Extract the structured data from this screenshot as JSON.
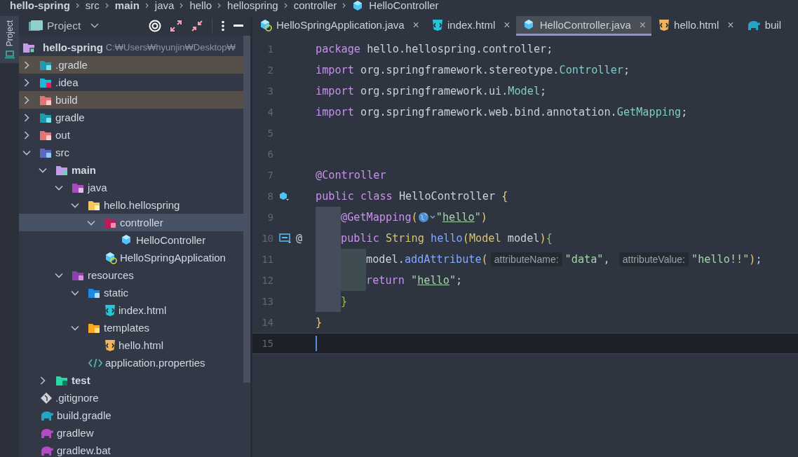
{
  "breadcrumb": [
    {
      "text": "hello-spring",
      "bold": true,
      "kind": "text"
    },
    {
      "text": "src",
      "bold": false,
      "kind": "text"
    },
    {
      "text": "main",
      "bold": true,
      "kind": "text"
    },
    {
      "text": "java",
      "bold": false,
      "kind": "text"
    },
    {
      "text": "hello",
      "bold": false,
      "kind": "text"
    },
    {
      "text": "hellospring",
      "bold": false,
      "kind": "text"
    },
    {
      "text": "controller",
      "bold": false,
      "kind": "text"
    },
    {
      "text": "HelloController",
      "bold": false,
      "kind": "class"
    }
  ],
  "side_strip": {
    "label": "Project",
    "selected": true
  },
  "project_panel": {
    "title": "Project",
    "root": {
      "name": "hello-spring",
      "path": "C:₩Users₩hyunjin₩Desktop₩",
      "kind": "module",
      "bold": true,
      "children": [
        {
          "name": ".gradle",
          "kind": "gradle-folder",
          "bold": false,
          "expanded": false,
          "ignored": true,
          "selected": false
        },
        {
          "name": ".idea",
          "kind": "idea-folder",
          "bold": false,
          "expanded": false,
          "ignored": false,
          "selected": false
        },
        {
          "name": "build",
          "kind": "excluded-folder",
          "bold": false,
          "expanded": false,
          "ignored": true,
          "selected": false
        },
        {
          "name": "gradle",
          "kind": "gradle-folder",
          "bold": false,
          "expanded": false,
          "ignored": false,
          "selected": false
        },
        {
          "name": "out",
          "kind": "excluded-folder",
          "bold": false,
          "expanded": false,
          "ignored": false,
          "selected": false
        },
        {
          "name": "src",
          "kind": "source-folder",
          "bold": false,
          "expanded": true,
          "ignored": false,
          "selected": false,
          "children": [
            {
              "name": "main",
              "kind": "module",
              "bold": true,
              "expanded": true,
              "ignored": false,
              "selected": false,
              "children": [
                {
                  "name": "java",
                  "kind": "java-root",
                  "bold": false,
                  "expanded": true,
                  "ignored": false,
                  "selected": false,
                  "children": [
                    {
                      "name": "hello.hellospring",
                      "kind": "package",
                      "bold": false,
                      "expanded": true,
                      "ignored": false,
                      "selected": false,
                      "children": [
                        {
                          "name": "controller",
                          "kind": "controller-package",
                          "bold": false,
                          "expanded": true,
                          "ignored": false,
                          "selected": true,
                          "children": [
                            {
                              "name": "HelloController",
                              "kind": "class",
                              "bold": false,
                              "ignored": false,
                              "selected": false
                            }
                          ]
                        },
                        {
                          "name": "HelloSpringApplication",
                          "kind": "spring-app",
                          "bold": false,
                          "ignored": false,
                          "selected": false
                        }
                      ]
                    }
                  ]
                },
                {
                  "name": "resources",
                  "kind": "resources",
                  "bold": false,
                  "expanded": true,
                  "ignored": false,
                  "selected": false,
                  "children": [
                    {
                      "name": "static",
                      "kind": "web-folder",
                      "bold": false,
                      "expanded": true,
                      "ignored": false,
                      "selected": false,
                      "children": [
                        {
                          "name": "index.html",
                          "kind": "web-file",
                          "bold": false,
                          "ignored": false,
                          "selected": false
                        }
                      ]
                    },
                    {
                      "name": "templates",
                      "kind": "template-folder",
                      "bold": false,
                      "expanded": true,
                      "ignored": false,
                      "selected": false,
                      "children": [
                        {
                          "name": "hello.html",
                          "kind": "html5",
                          "bold": false,
                          "ignored": false,
                          "selected": false
                        }
                      ]
                    },
                    {
                      "name": "application.properties",
                      "kind": "properties",
                      "bold": false,
                      "ignored": false,
                      "selected": false
                    }
                  ]
                }
              ]
            },
            {
              "name": "test",
              "kind": "test-folder",
              "bold": true,
              "expanded": false,
              "ignored": false,
              "selected": false
            }
          ]
        },
        {
          "name": ".gitignore",
          "kind": "gitignore",
          "bold": false,
          "ignored": false,
          "selected": false
        },
        {
          "name": "build.gradle",
          "kind": "gradle-file",
          "bold": false,
          "ignored": false,
          "selected": false
        },
        {
          "name": "gradlew",
          "kind": "gradlew",
          "bold": false,
          "ignored": false,
          "selected": false
        },
        {
          "name": "gradlew.bat",
          "kind": "gradlew",
          "bold": false,
          "ignored": false,
          "selected": false
        }
      ]
    }
  },
  "tabs": [
    {
      "label": "HelloSpringApplication.java",
      "kind": "spring-app",
      "selected": false,
      "close": "×"
    },
    {
      "label": "index.html",
      "kind": "web-file",
      "selected": false,
      "close": "×"
    },
    {
      "label": "HelloController.java",
      "kind": "class",
      "selected": true,
      "close": "×"
    },
    {
      "label": "hello.html",
      "kind": "html5",
      "selected": false,
      "close": "×"
    },
    {
      "label": "buil",
      "kind": "gradle-file",
      "selected": false
    }
  ],
  "code": [
    {
      "number": "1",
      "current": false,
      "tokens": [
        {
          "kind": "keyword",
          "text": "package"
        },
        {
          "kind": "plain",
          "text": " hello.hellospring.controller;"
        }
      ]
    },
    {
      "number": "2",
      "current": false,
      "tokens": [
        {
          "kind": "keyword",
          "text": "import"
        },
        {
          "kind": "plain",
          "text": " org.springframework.stereotype."
        },
        {
          "kind": "type",
          "text": "Controller"
        },
        {
          "kind": "plain",
          "text": ";"
        }
      ]
    },
    {
      "number": "3",
      "current": false,
      "tokens": [
        {
          "kind": "keyword",
          "text": "import"
        },
        {
          "kind": "plain",
          "text": " org.springframework.ui."
        },
        {
          "kind": "type",
          "text": "Model"
        },
        {
          "kind": "plain",
          "text": ";"
        }
      ]
    },
    {
      "number": "4",
      "current": false,
      "tokens": [
        {
          "kind": "keyword",
          "text": "import"
        },
        {
          "kind": "plain",
          "text": " org.springframework.web.bind.annotation."
        },
        {
          "kind": "type",
          "text": "GetMapping"
        },
        {
          "kind": "plain",
          "text": ";"
        }
      ]
    },
    {
      "number": "5",
      "current": false
    },
    {
      "number": "6",
      "current": false
    },
    {
      "number": "7",
      "current": false,
      "tokens": [
        {
          "kind": "annotation",
          "text": "@Controller"
        }
      ]
    },
    {
      "number": "8",
      "current": false,
      "gutter": [
        {
          "kind": "class"
        }
      ],
      "tokens": [
        {
          "kind": "keyword",
          "text": "public class"
        },
        {
          "kind": "plain",
          "text": " HelloController "
        },
        {
          "kind": "brace",
          "text": "{"
        }
      ]
    },
    {
      "number": "9",
      "current": false,
      "tokens": [
        {
          "kind": "indent"
        },
        {
          "kind": "annotation",
          "text": "@GetMapping"
        },
        {
          "kind": "brace",
          "text": "("
        },
        {
          "kind": "globe"
        },
        {
          "kind": "string",
          "text": "\""
        },
        {
          "kind": "link",
          "text": "hello"
        },
        {
          "kind": "string",
          "text": "\""
        },
        {
          "kind": "brace",
          "text": ")"
        }
      ]
    },
    {
      "number": "10",
      "current": false,
      "gutter": [
        {
          "kind": "api"
        },
        {
          "kind": "text",
          "text": "@"
        }
      ],
      "tokens": [
        {
          "kind": "indent"
        },
        {
          "kind": "keyword",
          "text": "public "
        },
        {
          "kind": "type2",
          "text": "String "
        },
        {
          "kind": "method",
          "text": "hello"
        },
        {
          "kind": "brace",
          "text": "("
        },
        {
          "kind": "type2",
          "text": "Model"
        },
        {
          "kind": "plain",
          "text": " model"
        },
        {
          "kind": "brace",
          "text": ")"
        },
        {
          "kind": "brace2",
          "text": "{"
        }
      ]
    },
    {
      "number": "11",
      "current": false,
      "tokens": [
        {
          "kind": "indent"
        },
        {
          "kind": "indent"
        },
        {
          "kind": "plain",
          "text": "model."
        },
        {
          "kind": "method",
          "text": "addAttribute"
        },
        {
          "kind": "brace",
          "text": "("
        },
        {
          "kind": "hint",
          "text": "attributeName:"
        },
        {
          "kind": "string",
          "text": "\"data\""
        },
        {
          "kind": "plain",
          "text": ", "
        },
        {
          "kind": "hint",
          "text": "attributeValue:"
        },
        {
          "kind": "string",
          "text": "\"hello!!\""
        },
        {
          "kind": "brace",
          "text": ")"
        },
        {
          "kind": "plain",
          "text": ";"
        }
      ]
    },
    {
      "number": "12",
      "current": false,
      "tokens": [
        {
          "kind": "indent"
        },
        {
          "kind": "indent"
        },
        {
          "kind": "keyword",
          "text": "return "
        },
        {
          "kind": "string",
          "text": "\""
        },
        {
          "kind": "link",
          "text": "hello"
        },
        {
          "kind": "string",
          "text": "\""
        },
        {
          "kind": "plain",
          "text": ";"
        }
      ]
    },
    {
      "number": "13",
      "current": false,
      "tokens": [
        {
          "kind": "indent"
        },
        {
          "kind": "brace2",
          "text": "}"
        }
      ]
    },
    {
      "number": "14",
      "current": false,
      "tokens": [
        {
          "kind": "brace",
          "text": "}"
        }
      ]
    },
    {
      "number": "15",
      "current": true
    }
  ]
}
